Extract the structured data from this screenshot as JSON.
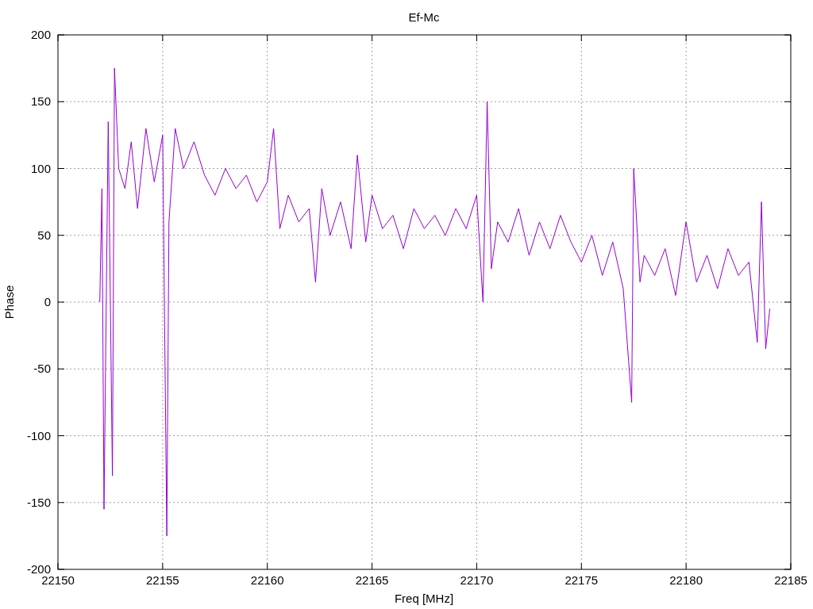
{
  "chart_data": {
    "type": "line",
    "grid": true,
    "title": "Ef-Mc",
    "xlabel": "Freq [MHz]",
    "ylabel": "Phase",
    "xlim": [
      22150,
      22185
    ],
    "ylim": [
      -200,
      200
    ],
    "xticks": [
      22150,
      22155,
      22160,
      22165,
      22170,
      22175,
      22180,
      22185
    ],
    "yticks": [
      -200,
      -150,
      -100,
      -50,
      0,
      50,
      100,
      150,
      200
    ],
    "x": [
      22152.0,
      22152.1,
      22152.2,
      22152.4,
      22152.6,
      22152.7,
      22152.9,
      22153.2,
      22153.5,
      22153.8,
      22154.2,
      22154.6,
      22155.0,
      22155.2,
      22155.3,
      22155.6,
      22156.0,
      22156.5,
      22157.0,
      22157.5,
      22158.0,
      22158.5,
      22159.0,
      22159.5,
      22160.0,
      22160.3,
      22160.6,
      22161.0,
      22161.5,
      22162.0,
      22162.3,
      22162.6,
      22163.0,
      22163.5,
      22164.0,
      22164.3,
      22164.7,
      22165.0,
      22165.5,
      22166.0,
      22166.5,
      22167.0,
      22167.5,
      22168.0,
      22168.5,
      22169.0,
      22169.5,
      22170.0,
      22170.3,
      22170.5,
      22170.7,
      22171.0,
      22171.5,
      22172.0,
      22172.5,
      22173.0,
      22173.5,
      22174.0,
      22174.5,
      22175.0,
      22175.5,
      22176.0,
      22176.5,
      22177.0,
      22177.4,
      22177.5,
      22177.8,
      22178.0,
      22178.5,
      22179.0,
      22179.5,
      22180.0,
      22180.5,
      22181.0,
      22181.5,
      22182.0,
      22182.5,
      22183.0,
      22183.4,
      22183.6,
      22183.8,
      22184.0
    ],
    "series": [
      {
        "color": "#9400d3",
        "values": [
          0,
          85,
          -155,
          135,
          -130,
          175,
          100,
          85,
          120,
          70,
          130,
          90,
          125,
          -175,
          60,
          130,
          100,
          120,
          95,
          80,
          100,
          85,
          95,
          75,
          90,
          130,
          55,
          80,
          60,
          70,
          15,
          85,
          50,
          75,
          40,
          110,
          45,
          80,
          55,
          65,
          40,
          70,
          55,
          65,
          50,
          70,
          55,
          80,
          0,
          150,
          25,
          60,
          45,
          70,
          35,
          60,
          40,
          65,
          45,
          30,
          50,
          20,
          45,
          10,
          -75,
          100,
          15,
          35,
          20,
          40,
          5,
          60,
          15,
          35,
          10,
          40,
          20,
          30,
          -30,
          75,
          -35,
          -5
        ]
      }
    ]
  }
}
